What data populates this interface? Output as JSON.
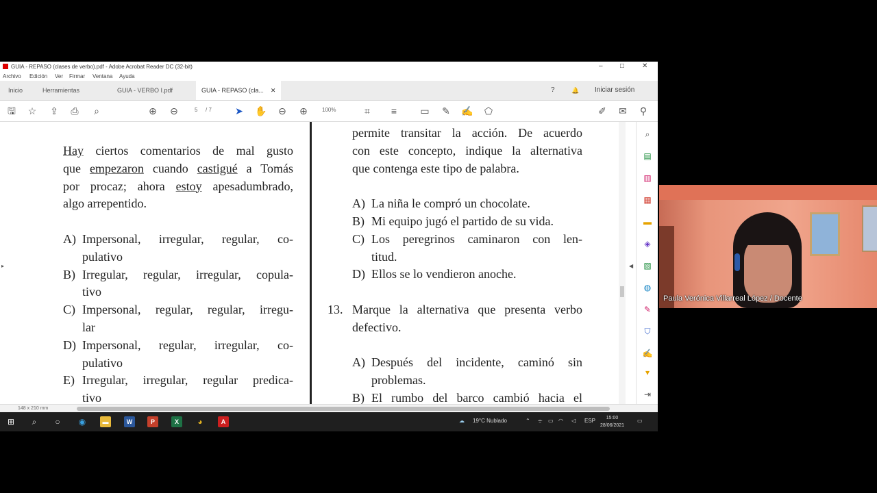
{
  "window": {
    "title": "GUIA - REPASO (clases de verbo).pdf - Adobe Acrobat Reader DC (32-bit)",
    "minimize": "–",
    "maximize": "□",
    "close": "✕"
  },
  "menu": [
    "Archivo",
    "Edición",
    "Ver",
    "Firmar",
    "Ventana",
    "Ayuda"
  ],
  "tabs": {
    "inicio": "Inicio",
    "herramientas": "Herramientas",
    "doc1": "GUIA - VERBO I.pdf",
    "doc2": "GUIA - REPASO (cla...",
    "close": "✕",
    "signin": "Iniciar sesión",
    "help_icon": "?",
    "bell_icon": "🔔"
  },
  "toolbar": {
    "page_current": "5",
    "page_total": "/ 7",
    "zoom": "100%"
  },
  "left_column": {
    "stem_lines": [
      [
        "Hay",
        " ciertos comentarios de mal gusto"
      ],
      [
        "que ",
        "empezaron",
        " cuando ",
        "castigué",
        " a Tomás"
      ],
      [
        "por procaz; ahora ",
        "estoy",
        " apesadumbrado,"
      ],
      [
        "algo arrepentido."
      ]
    ],
    "options": [
      {
        "label": "A)",
        "lines": [
          "Impersonal, irregular, regular, co-",
          "pulativo"
        ]
      },
      {
        "label": "B)",
        "lines": [
          "Irregular, regular, irregular, copula-",
          "tivo"
        ]
      },
      {
        "label": "C)",
        "lines": [
          "Impersonal, regular, regular, irregu-",
          "lar"
        ]
      },
      {
        "label": "D)",
        "lines": [
          "Impersonal, regular, irregular, co-",
          "pulativo"
        ]
      },
      {
        "label": "E)",
        "lines": [
          "Irregular, irregular, regular predica-",
          "tivo"
        ]
      }
    ]
  },
  "right_column": {
    "intro_lines": [
      "permite transitar la acción. De acuerdo",
      "con este concepto, indique la alternativa",
      "que contenga este tipo de palabra."
    ],
    "options_12": [
      {
        "label": "A)",
        "lines": [
          "La niña le compró un chocolate."
        ]
      },
      {
        "label": "B)",
        "lines": [
          "Mi equipo jugó el partido de su vida."
        ]
      },
      {
        "label": "C)",
        "lines": [
          "Los peregrinos caminaron con len-",
          "titud."
        ]
      },
      {
        "label": "D)",
        "lines": [
          "Ellos se lo vendieron anoche."
        ]
      }
    ],
    "q13": {
      "number": "13.",
      "lines": [
        "Marque la alternativa que presenta verbo",
        "defectivo."
      ]
    },
    "options_13": [
      {
        "label": "A)",
        "lines": [
          "Después del incidente, caminó sin",
          "problemas."
        ]
      },
      {
        "label": "B)",
        "lines": [
          "El rumbo del barco cambió hacia el"
        ]
      }
    ]
  },
  "status": {
    "page_size": "148 x 210 mm"
  },
  "taskbar": {
    "weather": "19°C  Nublado",
    "lang": "ESP",
    "time": "15:00",
    "date": "28/06/2021"
  },
  "webcam": {
    "participant": "Paula Verónica Villarreal López / Docente"
  }
}
